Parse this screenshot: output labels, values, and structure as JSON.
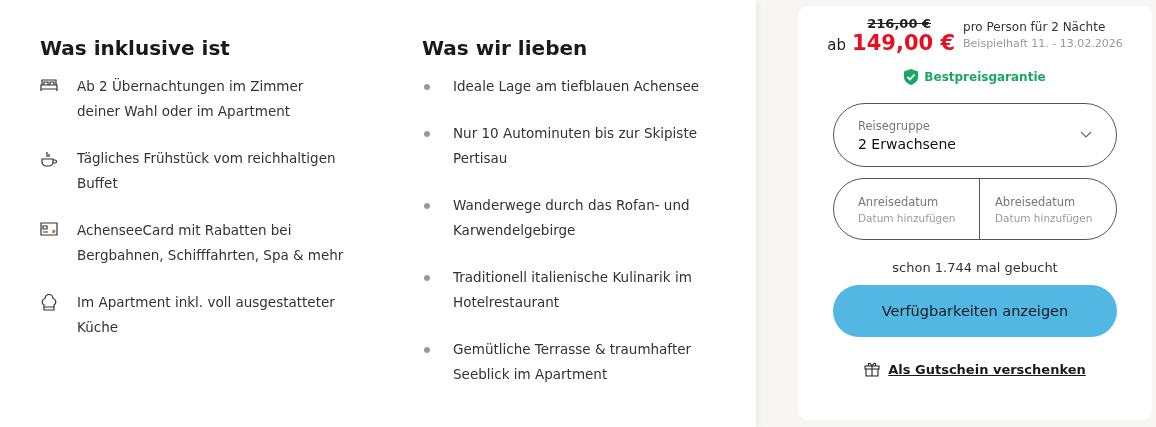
{
  "included": {
    "title": "Was inklusive ist",
    "items": [
      {
        "kind": "bed",
        "text": "Ab 2 Übernachtungen im Zimmer deiner Wahl oder im Apartment"
      },
      {
        "kind": "cup",
        "text": "Tägliches Frühstück vom reichhaltigen Buffet"
      },
      {
        "kind": "card",
        "text": "AchenseeCard mit Rabatten bei Bergbahnen, Schifffahrten, Spa & mehr"
      },
      {
        "kind": "chef",
        "text": "Im Apartment inkl. voll ausgestatteter Küche"
      }
    ]
  },
  "loved": {
    "title": "Was wir lieben",
    "items": [
      "Ideale Lage am tiefblauen Achensee",
      "Nur 10 Autominuten bis zur Skipiste Pertisau",
      "Wanderwege durch das Rofan- und Karwendelgebirge",
      "Traditionell italienische Kulinarik im Hotelrestaurant",
      "Gemütliche Terrasse & traumhafter Seeblick im Apartment"
    ]
  },
  "booking": {
    "old_price": "216,00 €",
    "price_prefix": "ab",
    "price": "149,00 €",
    "per": "pro Person für 2 Nächte",
    "example": "Beispielhaft 11. - 13.02.2026",
    "guarantee": "Bestpreisgarantie",
    "group": {
      "label": "Reisegruppe",
      "value": "2 Erwachsene"
    },
    "dates": [
      {
        "label": "Anreisedatum",
        "placeholder": "Datum hinzufügen"
      },
      {
        "label": "Abreisedatum",
        "placeholder": "Datum hinzufügen"
      }
    ],
    "booked": "schon 1.744 mal gebucht",
    "button": "Verfügbarkeiten anzeigen",
    "voucher": "Als Gutschein verschenken"
  }
}
